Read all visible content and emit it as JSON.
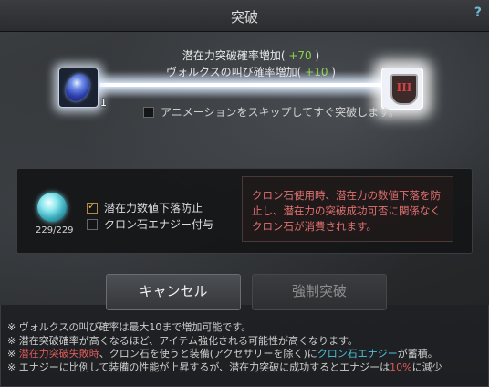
{
  "window": {
    "title": "突破",
    "help_label": "?"
  },
  "breakthrough": {
    "rate_label": "潜在力突破確率増加(",
    "rate_value": "+70",
    "rate_suffix": ")",
    "vorukus_label": "ヴォルクスの叫び確率増加(",
    "vorukus_value": "+10",
    "vorukus_suffix": ")",
    "left_slot_count": "1",
    "right_slot_numeral": "III",
    "skip_animation_label": "アニメーションをスキップしてすぐ突破します。"
  },
  "options": {
    "orb_count": "229/229",
    "prevent_drop_label": "潜在力数値下落防止",
    "prevent_drop_checked": true,
    "cron_energy_label": "クロン石エナジー付与",
    "cron_energy_checked": false,
    "description": "クロン石使用時、潜在力の数値下落を防止し、潜在力の突破成功可否に関係なくクロン石が消費されます。"
  },
  "buttons": {
    "cancel": "キャンセル",
    "force_breakthrough": "強制突破"
  },
  "notes": {
    "line1": "※ ヴォルクスの叫び確率は最大10まで増加可能です。",
    "line2": "※ 潜在突破確率が高くなるほど、アイテム強化される可能性が高くなります。",
    "line3_prefix": "※ ",
    "line3_red": "潜在力突破失敗時",
    "line3_mid": "、クロン石を使うと装備(アクセサリーを除く)に",
    "line3_cyan": "クロン石エナジー",
    "line3_suffix": "が蓄積。",
    "line4_prefix": "※ エナジーに比例して装備の性能が上昇するが、潜在力突破に成功するとエナジーは",
    "line4_red": "10%",
    "line4_suffix": "に減少"
  },
  "colors": {
    "positive": "#8bd449",
    "warning_text": "#e05a5a",
    "highlight_cyan": "#4cc3d9"
  }
}
